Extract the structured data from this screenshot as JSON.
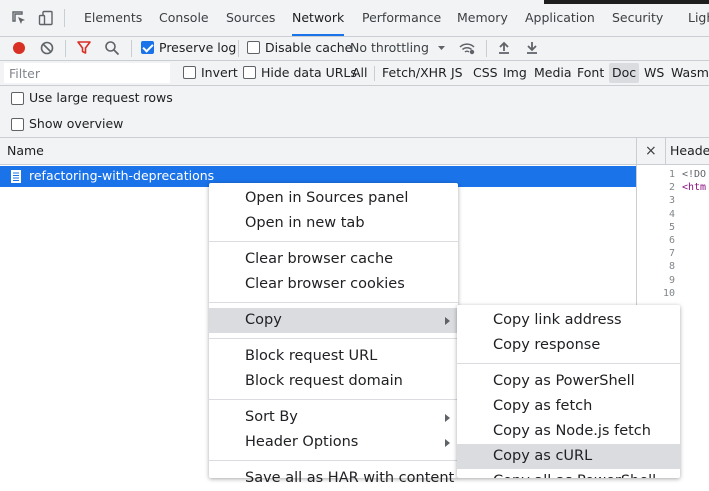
{
  "tabs": [
    {
      "label": "Elements"
    },
    {
      "label": "Console"
    },
    {
      "label": "Sources"
    },
    {
      "label": "Network"
    },
    {
      "label": "Performance"
    },
    {
      "label": "Memory"
    },
    {
      "label": "Application"
    },
    {
      "label": "Security"
    },
    {
      "label": "Ligh"
    }
  ],
  "toolbar": {
    "preserve_log": "Preserve log",
    "disable_cache": "Disable cache",
    "throttling": "No throttling"
  },
  "filterbar": {
    "placeholder": "Filter",
    "invert": "Invert",
    "hide_data_urls": "Hide data URLs",
    "types": [
      "All",
      "Fetch/XHR",
      "JS",
      "CSS",
      "Img",
      "Media",
      "Font",
      "Doc",
      "WS",
      "Wasm"
    ],
    "active_type": "Doc"
  },
  "options": {
    "large_rows": "Use large request rows",
    "overview": "Show overview"
  },
  "table": {
    "name_header": "Name",
    "rows": [
      "refactoring-with-deprecations"
    ]
  },
  "right_pane": {
    "close": "×",
    "tab_label": "Header",
    "line_numbers": [
      "1",
      "2",
      "3",
      "4",
      "5",
      "6",
      "7",
      "8",
      "9",
      "10"
    ],
    "code_lines": [
      "<!DO",
      "<htm"
    ]
  },
  "context_menu": {
    "items": [
      {
        "label": "Open in Sources panel"
      },
      {
        "label": "Open in new tab"
      },
      {
        "label": "Clear browser cache"
      },
      {
        "label": "Clear browser cookies"
      },
      {
        "label": "Copy"
      },
      {
        "label": "Block request URL"
      },
      {
        "label": "Block request domain"
      },
      {
        "label": "Sort By"
      },
      {
        "label": "Header Options"
      },
      {
        "label": "Save all as HAR with content"
      }
    ]
  },
  "copy_submenu": {
    "items": [
      {
        "label": "Copy link address"
      },
      {
        "label": "Copy response"
      },
      {
        "label": "Copy as PowerShell"
      },
      {
        "label": "Copy as fetch"
      },
      {
        "label": "Copy as Node.js fetch"
      },
      {
        "label": "Copy as cURL"
      },
      {
        "label": "Copy all as PowerShell"
      }
    ]
  },
  "colors": {
    "accent": "#1a73e8",
    "record": "#d93025",
    "filter_icon": "#d93025",
    "menu_highlight": "#dadce0"
  },
  "state": {
    "preserve_log_checked": true,
    "disable_cache_checked": false,
    "invert_checked": false,
    "hide_data_urls_checked": false,
    "large_rows_checked": false,
    "overview_checked": false
  }
}
